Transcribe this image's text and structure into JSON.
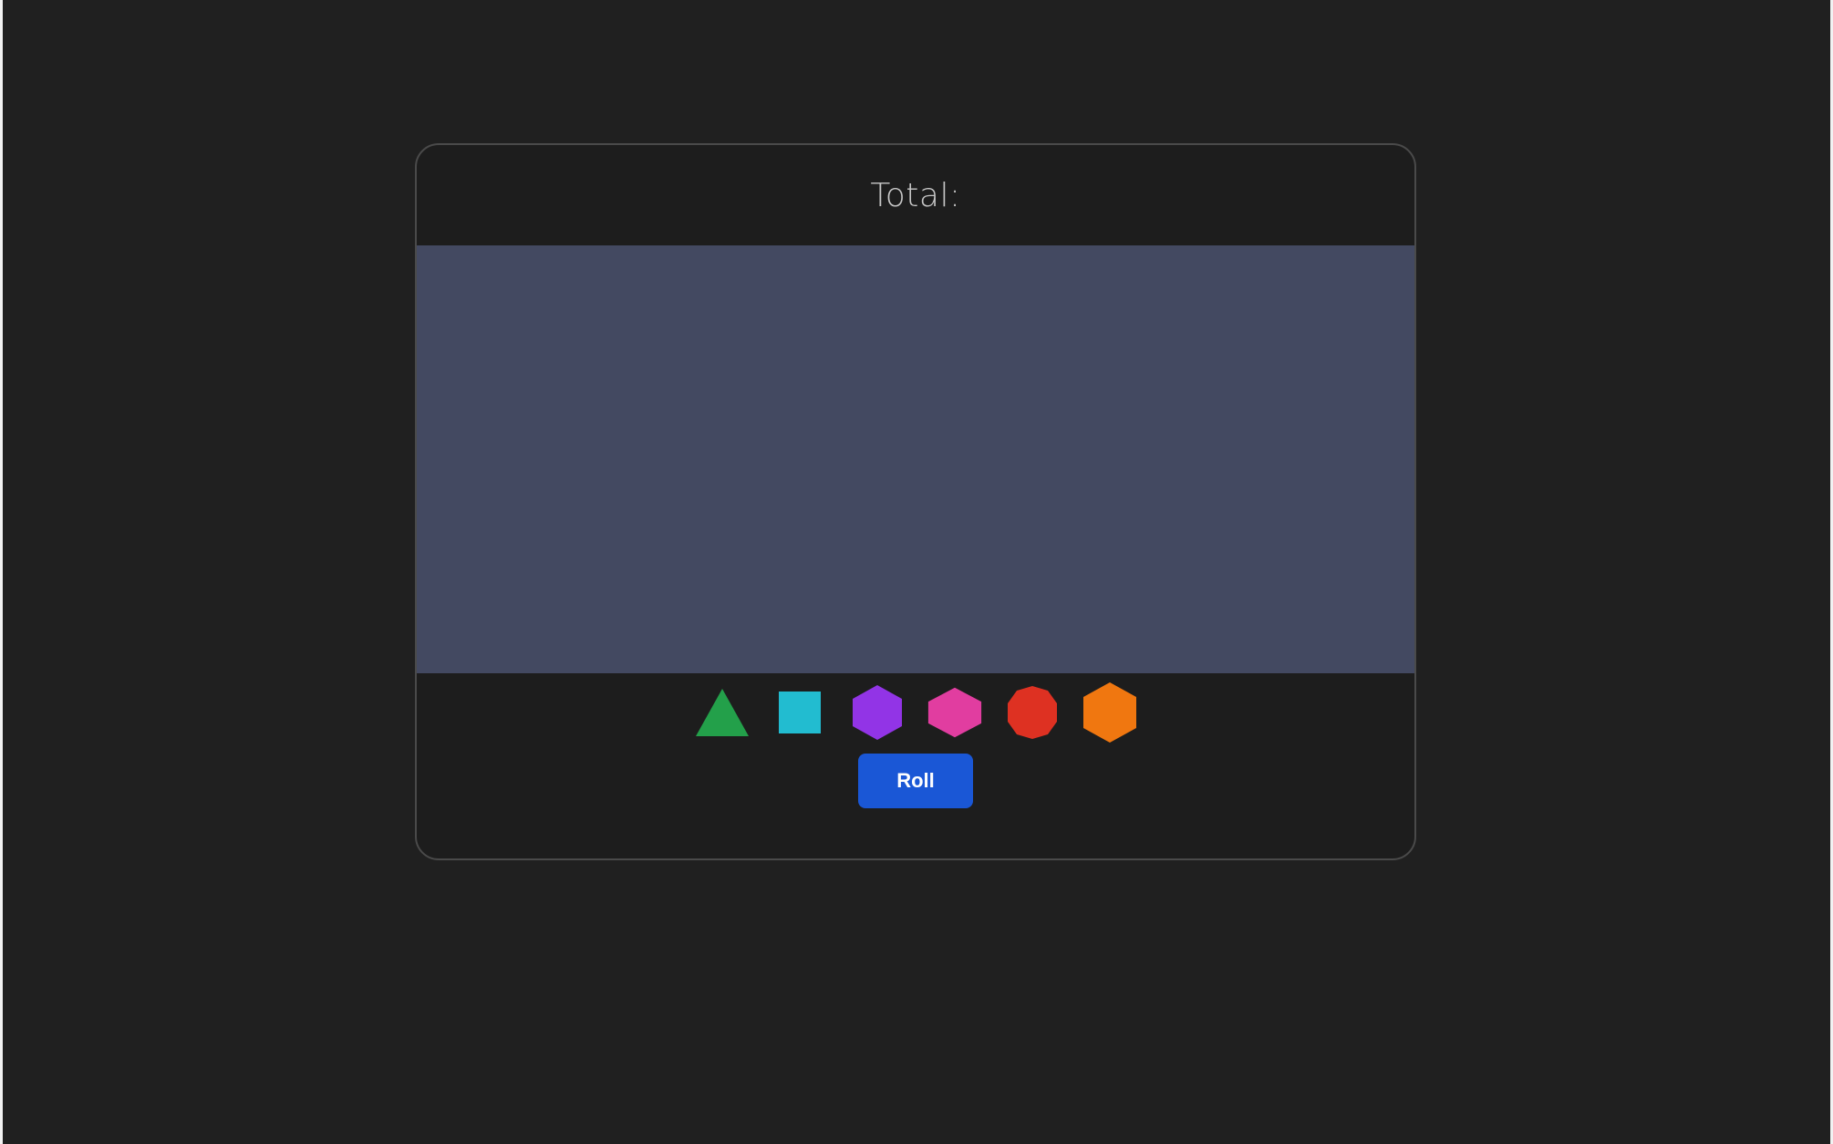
{
  "header": {
    "total_label": "Total:"
  },
  "dice": [
    {
      "name": "triangle-die-icon",
      "color": "#23a04a",
      "shape": "triangle"
    },
    {
      "name": "square-die-icon",
      "color": "#22bcd0",
      "shape": "square"
    },
    {
      "name": "purple-hexagon-die-icon",
      "color": "#9234e6",
      "shape": "hexagon-vertical"
    },
    {
      "name": "pink-diamond-die-icon",
      "color": "#e13da0",
      "shape": "hexagon-wide"
    },
    {
      "name": "red-decagon-die-icon",
      "color": "#de3122",
      "shape": "decagon"
    },
    {
      "name": "orange-hexagon-die-icon",
      "color": "#f07710",
      "shape": "hexagon-vertical"
    }
  ],
  "controls": {
    "roll_label": "Roll"
  },
  "colors": {
    "background": "#202020",
    "panel": "#1d1d1d",
    "tray": "#434961",
    "roll_button": "#1a57d6"
  }
}
